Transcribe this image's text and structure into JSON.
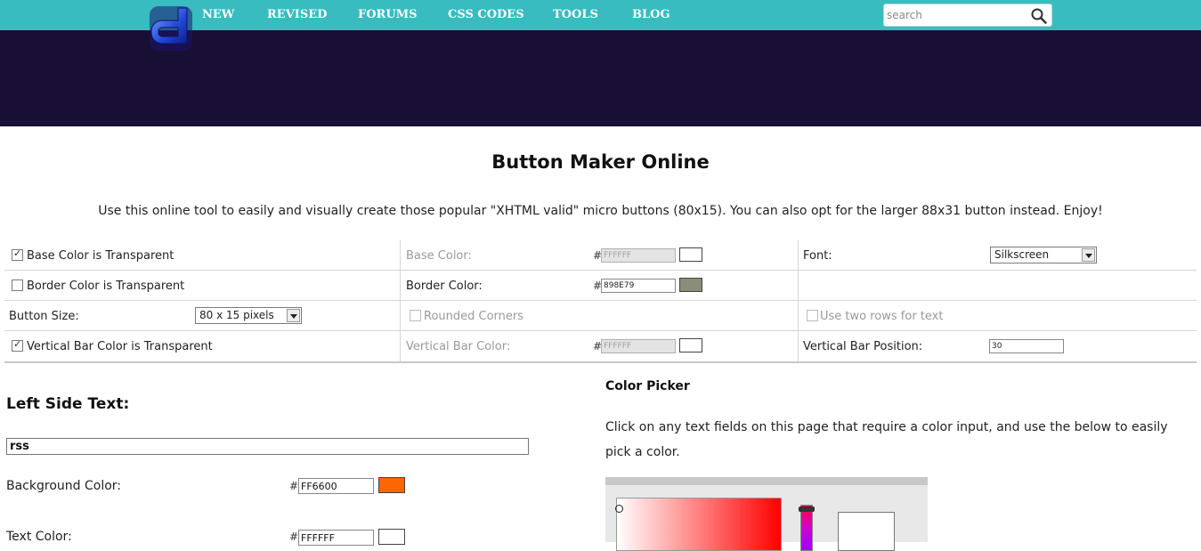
{
  "nav": {
    "items": [
      "NEW",
      "REVISED",
      "FORUMS",
      "CSS CODES",
      "TOOLS",
      "BLOG"
    ],
    "search_placeholder": "search"
  },
  "colors": {
    "topbar": "#38bcc0",
    "header": "#190e33",
    "base_color": "#FFFFFF",
    "border_color": "#898E79",
    "vbar_color": "#FFFFFF",
    "bg_color": "#FF6600",
    "text_color": "#FFFFFF"
  },
  "icons": {
    "logo": "d-logo",
    "search": "search-icon"
  },
  "page": {
    "title": "Button Maker Online",
    "intro": "Use this online tool to easily and visually create those popular \"XHTML valid\" micro buttons (80x15). You can also opt for the larger 88x31 button instead. Enjoy!"
  },
  "options": {
    "base_transparent": {
      "label": "Base Color is Transparent",
      "checked": true
    },
    "base_color": {
      "label": "Base Color:",
      "hash": "#",
      "value": "FFFFFF"
    },
    "font": {
      "label": "Font:",
      "value": "Silkscreen"
    },
    "border_transparent": {
      "label": "Border Color is Transparent",
      "checked": false
    },
    "border_color": {
      "label": "Border Color:",
      "hash": "#",
      "value": "898E79"
    },
    "button_size": {
      "label": "Button Size:",
      "value": "80 x 15 pixels"
    },
    "rounded": {
      "label": "Rounded Corners",
      "checked": false
    },
    "two_rows": {
      "label": "Use two rows for text",
      "checked": false
    },
    "vbar_transparent": {
      "label": "Vertical Bar Color is Transparent",
      "checked": true
    },
    "vbar_color": {
      "label": "Vertical Bar Color:",
      "hash": "#",
      "value": "FFFFFF"
    },
    "vbar_position": {
      "label": "Vertical Bar Position:",
      "value": "30"
    }
  },
  "left_side": {
    "title": "Left Side Text:",
    "text_value": "rss",
    "bg_label": "Background Color:",
    "bg_hash": "#",
    "bg_value": "FF6600",
    "text_color_label": "Text Color:",
    "text_color_hash": "#",
    "text_color_value": "FFFFFF"
  },
  "color_picker": {
    "title": "Color Picker",
    "desc": "Click on any text fields on this page that require a color input, and use the below to easily pick a color."
  }
}
